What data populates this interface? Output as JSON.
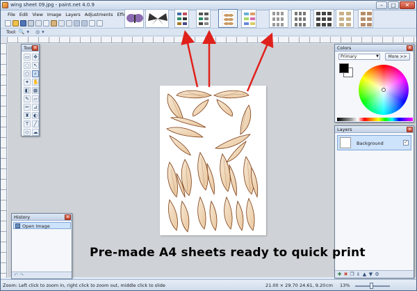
{
  "window": {
    "title": "wing sheet 09.jpg - paint.net 4.0.9",
    "minimize": "–",
    "maximize": "□",
    "close": "✕"
  },
  "menu": [
    "File",
    "Edit",
    "View",
    "Image",
    "Layers",
    "Adjustments",
    "Effects"
  ],
  "toolbar": {
    "tool_label": "Tool:",
    "zoom_glyph": "🔍",
    "dropdown_glyph": "▾"
  },
  "panels": {
    "tools": {
      "title": "Tools",
      "close": "x"
    },
    "colors": {
      "title": "Colors",
      "mode": "Primary",
      "more": "More >>",
      "close": "x"
    },
    "layers": {
      "title": "Layers",
      "layer_name": "Background",
      "visible_check": "✓",
      "close": "x"
    },
    "history": {
      "title": "History",
      "item": "Open Image",
      "close": "x",
      "footer": "↶ ↷"
    }
  },
  "status": {
    "hint": "Zoom: Left click to zoom in, right click to zoom out, middle click to slide",
    "size": "21.00 × 29.70",
    "pos": "24.61, 9.20",
    "unit": "cm",
    "zoom": "13%"
  },
  "caption": "Pre-made A4 sheets ready to quick print",
  "colors": {
    "arrow": "#e0201b",
    "wing_edge": "#7a3b12",
    "wing_fill": "#f3dcc0"
  }
}
